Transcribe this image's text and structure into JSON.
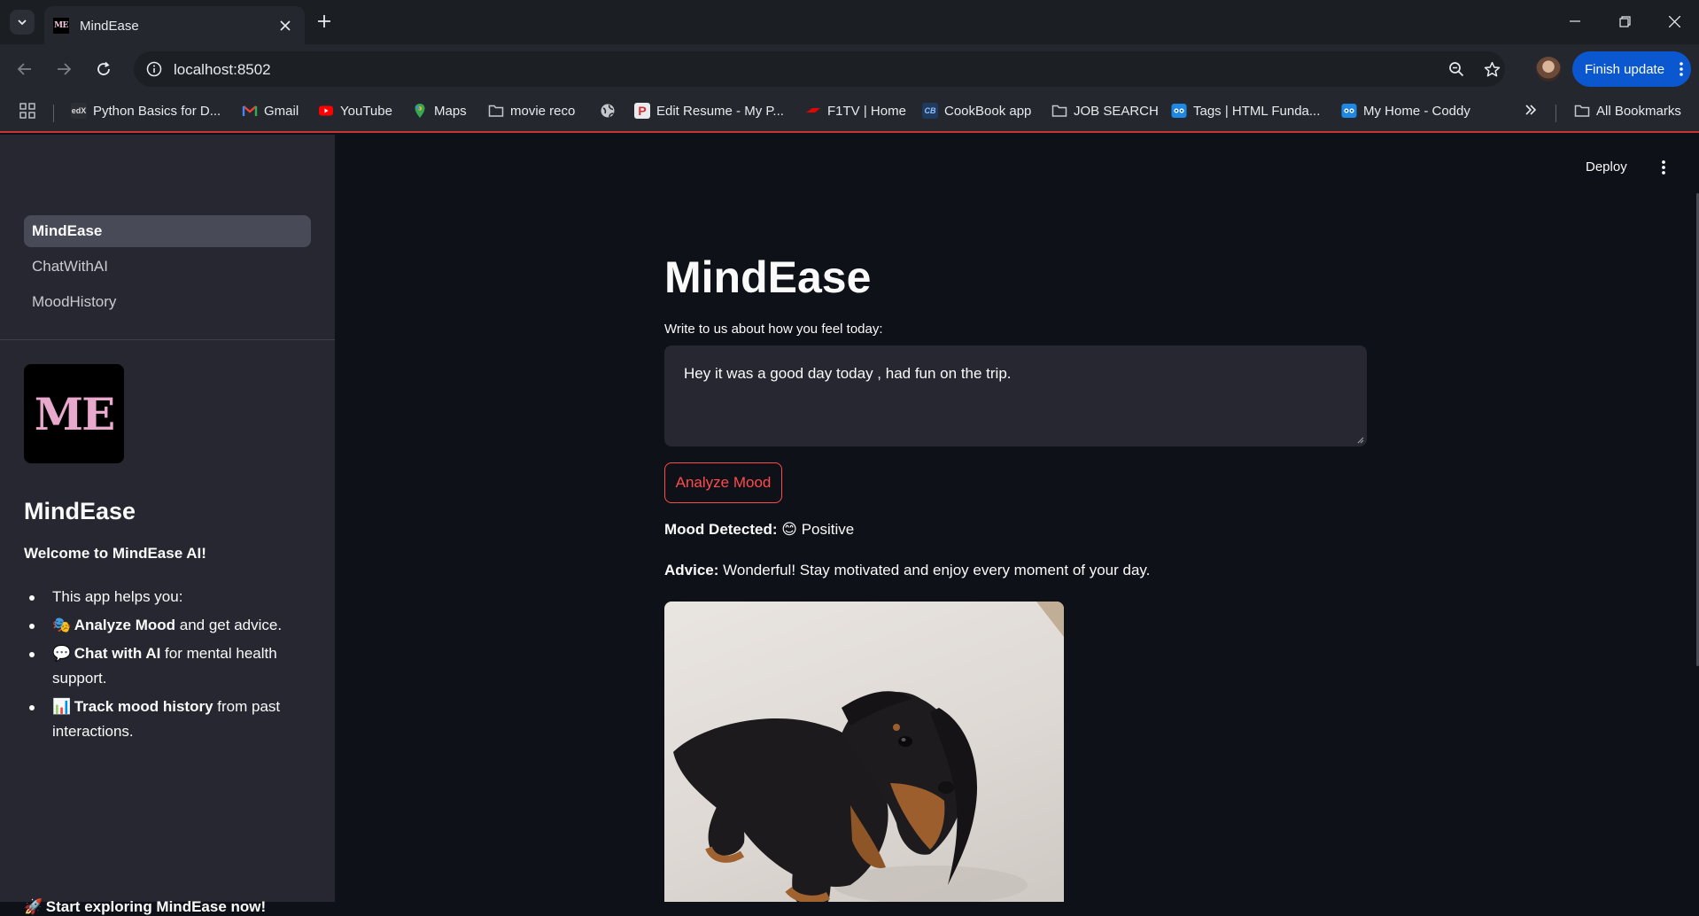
{
  "browser": {
    "tab_title": "MindEase",
    "url": "localhost:8502",
    "finish_update": "Finish update",
    "bookmarks": [
      {
        "label": "Python Basics for D...",
        "icon": "edx-icon"
      },
      {
        "label": "Gmail",
        "icon": "gmail-icon"
      },
      {
        "label": "YouTube",
        "icon": "youtube-icon"
      },
      {
        "label": "Maps",
        "icon": "maps-icon"
      },
      {
        "label": "movie reco",
        "icon": "folder-icon"
      },
      {
        "label": "",
        "icon": "globe-icon"
      },
      {
        "label": "Edit Resume - My P...",
        "icon": "resume-icon"
      },
      {
        "label": "F1TV | Home",
        "icon": "f1-icon"
      },
      {
        "label": "CookBook app",
        "icon": "cookbook-icon"
      },
      {
        "label": "JOB SEARCH",
        "icon": "folder-icon"
      },
      {
        "label": "Tags | HTML Funda...",
        "icon": "coddy-icon"
      },
      {
        "label": "My Home - Coddy",
        "icon": "coddy-icon"
      }
    ],
    "all_bookmarks": "All Bookmarks"
  },
  "sidebar": {
    "nav": [
      {
        "label": "MindEase",
        "active": true
      },
      {
        "label": "ChatWithAI",
        "active": false
      },
      {
        "label": "MoodHistory",
        "active": false
      }
    ],
    "logo_text": "ME",
    "title": "MindEase",
    "welcome": "Welcome to MindEase AI!",
    "list": {
      "item1": "This app helps you:",
      "item2_emoji": "🎭",
      "item2_bold": "Analyze Mood",
      "item2_rest": " and get advice.",
      "item3_emoji": "💬",
      "item3_bold": "Chat with AI",
      "item3_rest": " for mental health support.",
      "item4_emoji": "📊",
      "item4_bold": "Track mood history",
      "item4_rest": " from past interactions."
    },
    "cta_emoji": "🚀",
    "cta": "Start exploring MindEase now!"
  },
  "main": {
    "deploy": "Deploy",
    "title": "MindEase",
    "input_label": "Write to us about how you feel today:",
    "input_value": "Hey it was a good day today , had fun on the trip.",
    "analyze_button": "Analyze Mood",
    "mood_label": "Mood Detected:",
    "mood_emoji": "😊",
    "mood_value": "Positive",
    "advice_label": "Advice:",
    "advice_text": "Wonderful! Stay motivated and enjoy every moment of your day."
  },
  "colors": {
    "accent": "#ff4b4b",
    "background": "#0e1117",
    "sidebar": "#262730",
    "chrome_button": "#0b57d0"
  }
}
